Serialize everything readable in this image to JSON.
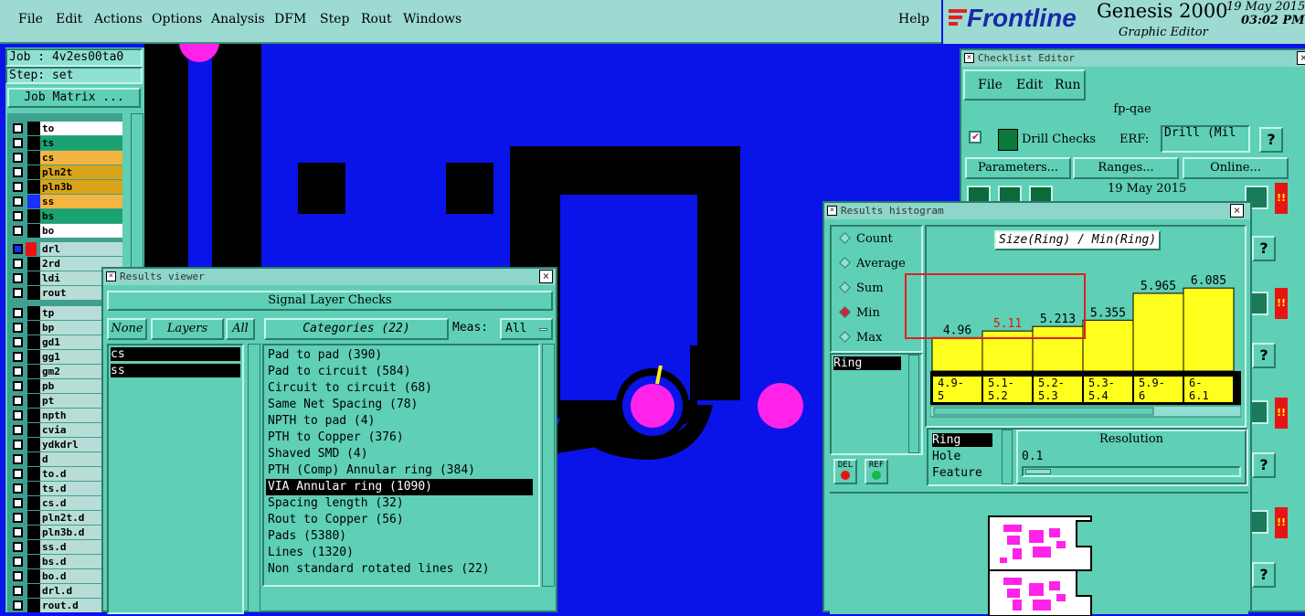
{
  "menu": [
    "File",
    "Edit",
    "Actions",
    "Options",
    "Analysis",
    "DFM",
    "Step",
    "Rout",
    "Windows"
  ],
  "help": "Help",
  "brand": {
    "logo": "Frontline",
    "product": "Genesis 2000",
    "subtitle": "Graphic Editor",
    "date": "19 May 2015",
    "time": "03:02 PM"
  },
  "job": {
    "job_label": "Job : 4v2es00ta0",
    "step_label": "Step: set",
    "matrix_button": "Job Matrix ..."
  },
  "layers_top": [
    {
      "name": "to",
      "color": "#ffffff"
    },
    {
      "name": "ts",
      "color": "#1aa371"
    },
    {
      "name": "cs",
      "color": "#f2b640"
    },
    {
      "name": "pln2t",
      "color": "#d9a41a"
    },
    {
      "name": "pln3b",
      "color": "#d9a41a"
    },
    {
      "name": "ss",
      "color": "#f2b640"
    },
    {
      "name": "bs",
      "color": "#1aa371"
    },
    {
      "name": "bo",
      "color": "#ffffff"
    }
  ],
  "layers_mid": [
    "drl",
    "2rd",
    "ldi",
    "rout"
  ],
  "layers_bottom": [
    "tp",
    "bp",
    "gd1",
    "gg1",
    "gm2",
    "pb",
    "pt",
    "npth",
    "cvia",
    "ydkdrl",
    "d",
    "to.d",
    "ts.d",
    "cs.d",
    "pln2t.d",
    "pln3b.d",
    "ss.d",
    "bs.d",
    "bo.d",
    "drl.d",
    "rout.d"
  ],
  "results_viewer": {
    "title": "Results viewer",
    "header": "Signal Layer Checks",
    "none_btn": "None",
    "layers_btn": "Layers",
    "all_btn": "All",
    "layers": [
      "cs",
      "ss"
    ],
    "categories_btn": "Categories (22)",
    "meas_label": "Meas:",
    "meas_value": "All",
    "categories": [
      "Pad to pad (390)",
      "Pad to circuit (584)",
      "Circuit to circuit (68)",
      "Same Net Spacing (78)",
      "NPTH to pad (4)",
      "PTH to Copper (376)",
      "Shaved SMD (4)",
      "PTH (Comp) Annular ring (384)",
      "VIA Annular ring (1090)",
      "Spacing length (32)",
      "Rout to Copper (56)",
      "Pads (5380)",
      "Lines (1320)",
      "Non standard rotated lines (22)"
    ],
    "selected_index": 8
  },
  "checklist": {
    "title": "Checklist Editor",
    "menu": [
      "File",
      "Edit",
      "Run"
    ],
    "name": "fp-qae",
    "check_name": "Drill Checks",
    "erf_label": "ERF:",
    "erf_value": "Drill (Mil",
    "help": "?",
    "buttons": [
      "Parameters...",
      "Ranges...",
      "Online..."
    ],
    "date": "19 May 2015"
  },
  "histogram": {
    "title": "Results histogram",
    "radio": [
      "Count",
      "Average",
      "Sum",
      "Min",
      "Max"
    ],
    "radio_selected": 3,
    "list": [
      "Ring"
    ],
    "heading": "Size(Ring) / Min(Ring)",
    "chart_data": {
      "type": "bar",
      "categories": [
        "4.9-5",
        "5.1-5.2",
        "5.2-5.3",
        "5.3-5.4",
        "5.9-6",
        "6-6.1"
      ],
      "values": [
        4.96,
        5.11,
        5.213,
        5.355,
        5.965,
        6.085
      ],
      "value_labels": [
        "4.96",
        "5.11",
        "5.213",
        "5.355",
        "5.965",
        "6.085"
      ],
      "range_labels": [
        [
          "4.9-",
          "5"
        ],
        [
          "5.1-",
          "5.2"
        ],
        [
          "5.2-",
          "5.3"
        ],
        [
          "5.3-",
          "5.4"
        ],
        [
          "5.9-",
          "6"
        ],
        [
          "6-",
          "6.1"
        ]
      ],
      "highlight_color": "#e81414",
      "bar_color": "#ffff1e",
      "ylim": [
        4.2,
        6.4
      ]
    },
    "options": [
      "Ring",
      "Hole",
      "Feature"
    ],
    "resolution_label": "Resolution",
    "resolution_value": "0.1",
    "del_btn": "DEL",
    "ref_btn": "REF"
  }
}
